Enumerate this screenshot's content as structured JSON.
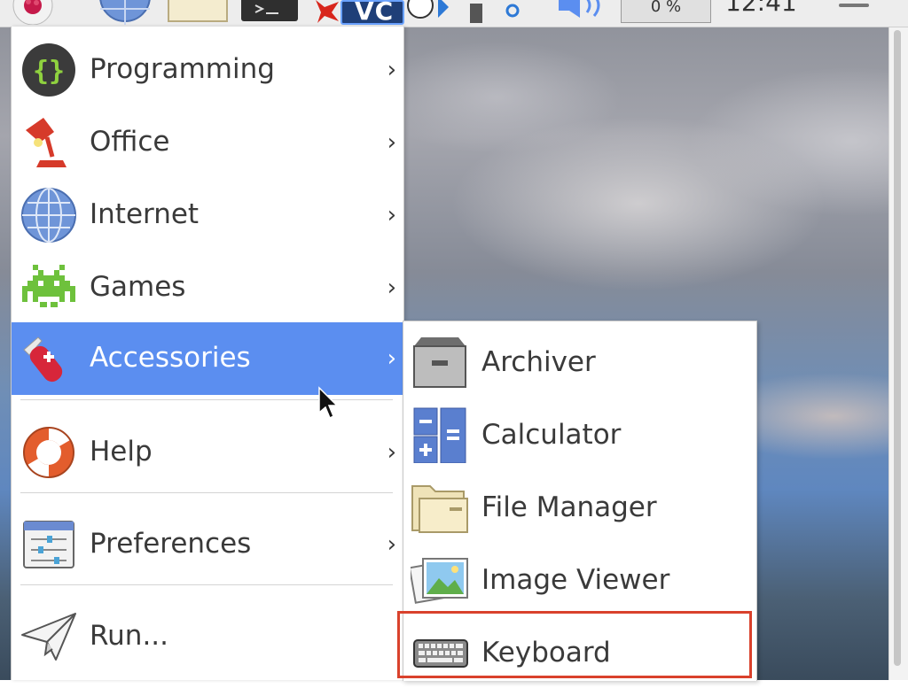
{
  "taskbar": {
    "cpu_label": "0 %",
    "clock": "12:41",
    "vc_label": "VC"
  },
  "menu": {
    "items": [
      {
        "label": "Programming",
        "arrow": "›",
        "icon": "braces-icon"
      },
      {
        "label": "Office",
        "arrow": "›",
        "icon": "desk-lamp-icon"
      },
      {
        "label": "Internet",
        "arrow": "›",
        "icon": "globe-icon"
      },
      {
        "label": "Games",
        "arrow": "›",
        "icon": "space-invader-icon"
      },
      {
        "label": "Accessories",
        "arrow": "›",
        "icon": "pocket-knife-icon"
      },
      {
        "label": "Help",
        "arrow": "›",
        "icon": "lifebuoy-icon"
      },
      {
        "label": "Preferences",
        "arrow": "›",
        "icon": "sliders-icon"
      },
      {
        "label": "Run...",
        "icon": "paper-plane-icon"
      }
    ],
    "active_item": "Accessories"
  },
  "submenu": {
    "items": [
      {
        "label": "Archiver",
        "icon": "archive-box-icon"
      },
      {
        "label": "Calculator",
        "icon": "calculator-icon"
      },
      {
        "label": "File Manager",
        "icon": "folder-icon"
      },
      {
        "label": "Image Viewer",
        "icon": "image-viewer-icon"
      },
      {
        "label": "Keyboard",
        "icon": "keyboard-icon"
      }
    ],
    "highlighted_item": "Keyboard"
  },
  "colors": {
    "active_bg": "#5b8ef0",
    "highlight_border": "#d9412c",
    "text": "#3a3a3a"
  }
}
